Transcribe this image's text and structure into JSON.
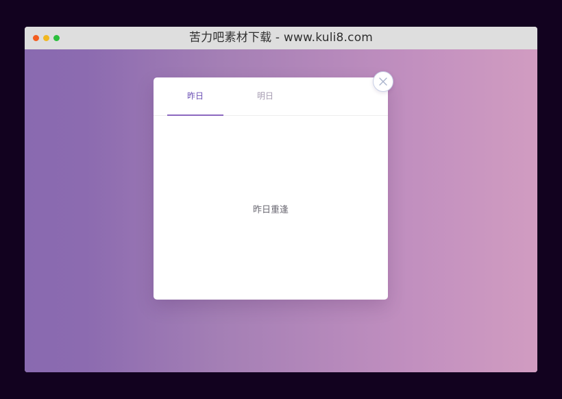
{
  "window": {
    "title": "苦力吧素材下载 - www.kuli8.com"
  },
  "modal": {
    "tabs": [
      {
        "label": "昨日",
        "active": true
      },
      {
        "label": "明日",
        "active": false
      }
    ],
    "panel_text": "昨日重逢",
    "close_icon": "close-icon"
  },
  "colors": {
    "accent": "#6b4fb4",
    "indicator": "#8b67bf",
    "page_bg": "#12021f"
  }
}
